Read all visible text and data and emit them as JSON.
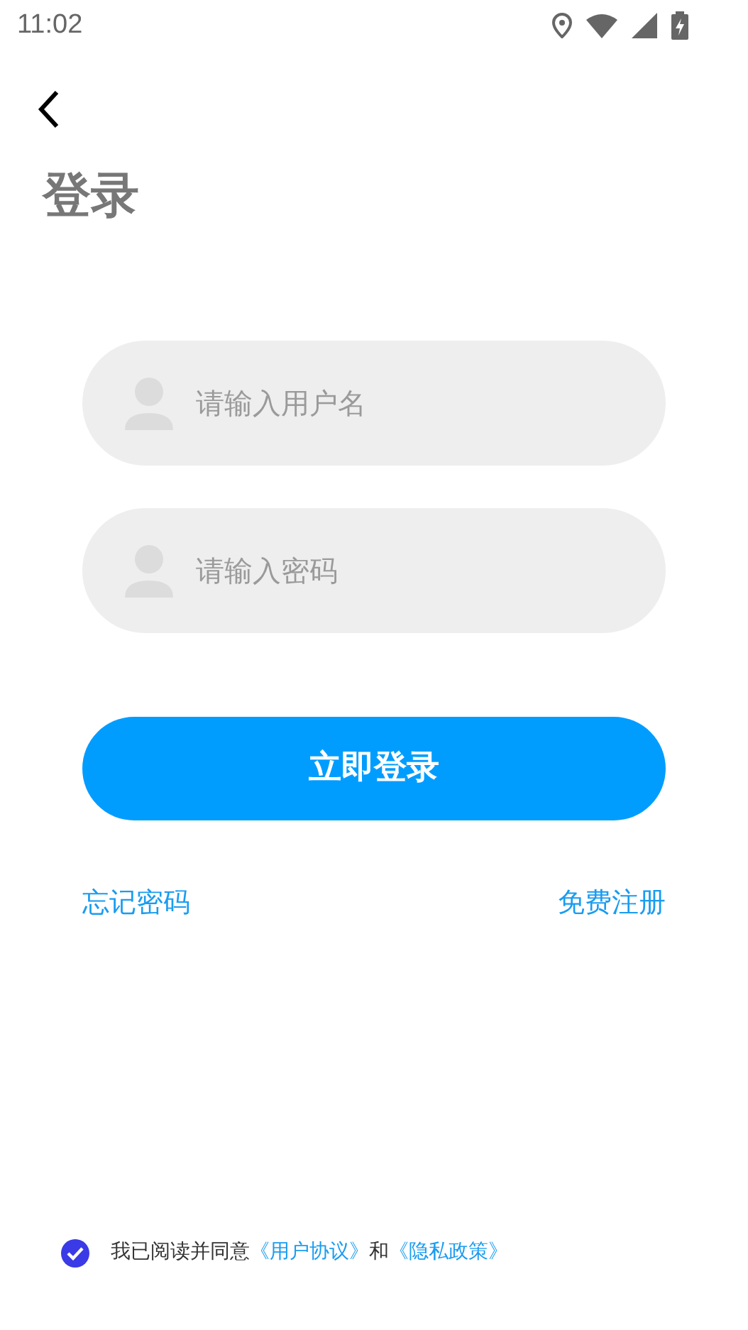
{
  "status_bar": {
    "time": "11:02"
  },
  "title": "登录",
  "fields": [
    {
      "placeholder": "请输入用户名"
    },
    {
      "placeholder": "请输入密码"
    }
  ],
  "login_button": "立即登录",
  "links": {
    "forgot": "忘记密码",
    "register": "免费注册"
  },
  "agreement": {
    "checked": true,
    "text": "我已阅读并同意",
    "user_agreement": "《用户协议》",
    "and": "和",
    "privacy_policy": "《隐私政策》"
  }
}
